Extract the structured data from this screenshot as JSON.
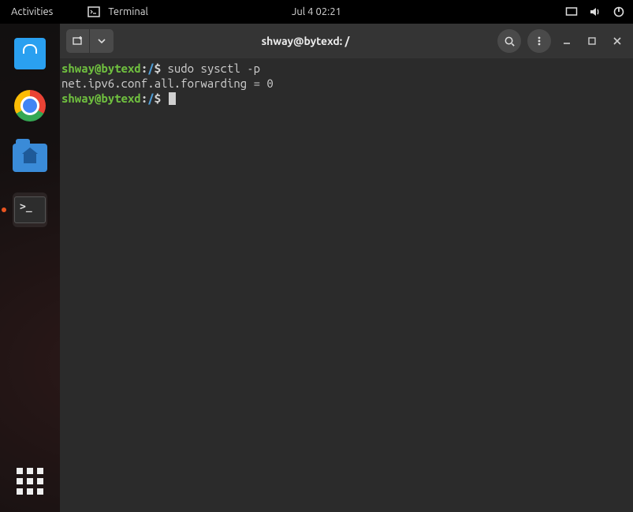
{
  "topbar": {
    "activities": "Activities",
    "app_label": "Terminal",
    "datetime": "Jul 4  02:21"
  },
  "dock": {
    "items": [
      {
        "name": "gnome-software"
      },
      {
        "name": "google-chrome"
      },
      {
        "name": "files"
      },
      {
        "name": "terminal",
        "active": true
      }
    ]
  },
  "terminal": {
    "title": "shway@bytexd: /",
    "lines": [
      {
        "user": "shway@bytexd",
        "path": "/",
        "cmd": "sudo sysctl -p"
      },
      {
        "output": "net.ipv6.conf.all.forwarding = 0"
      },
      {
        "user": "shway@bytexd",
        "path": "/",
        "cmd": "",
        "cursor": true
      }
    ],
    "prompt_sep": ":",
    "prompt_symbol": "$ "
  }
}
